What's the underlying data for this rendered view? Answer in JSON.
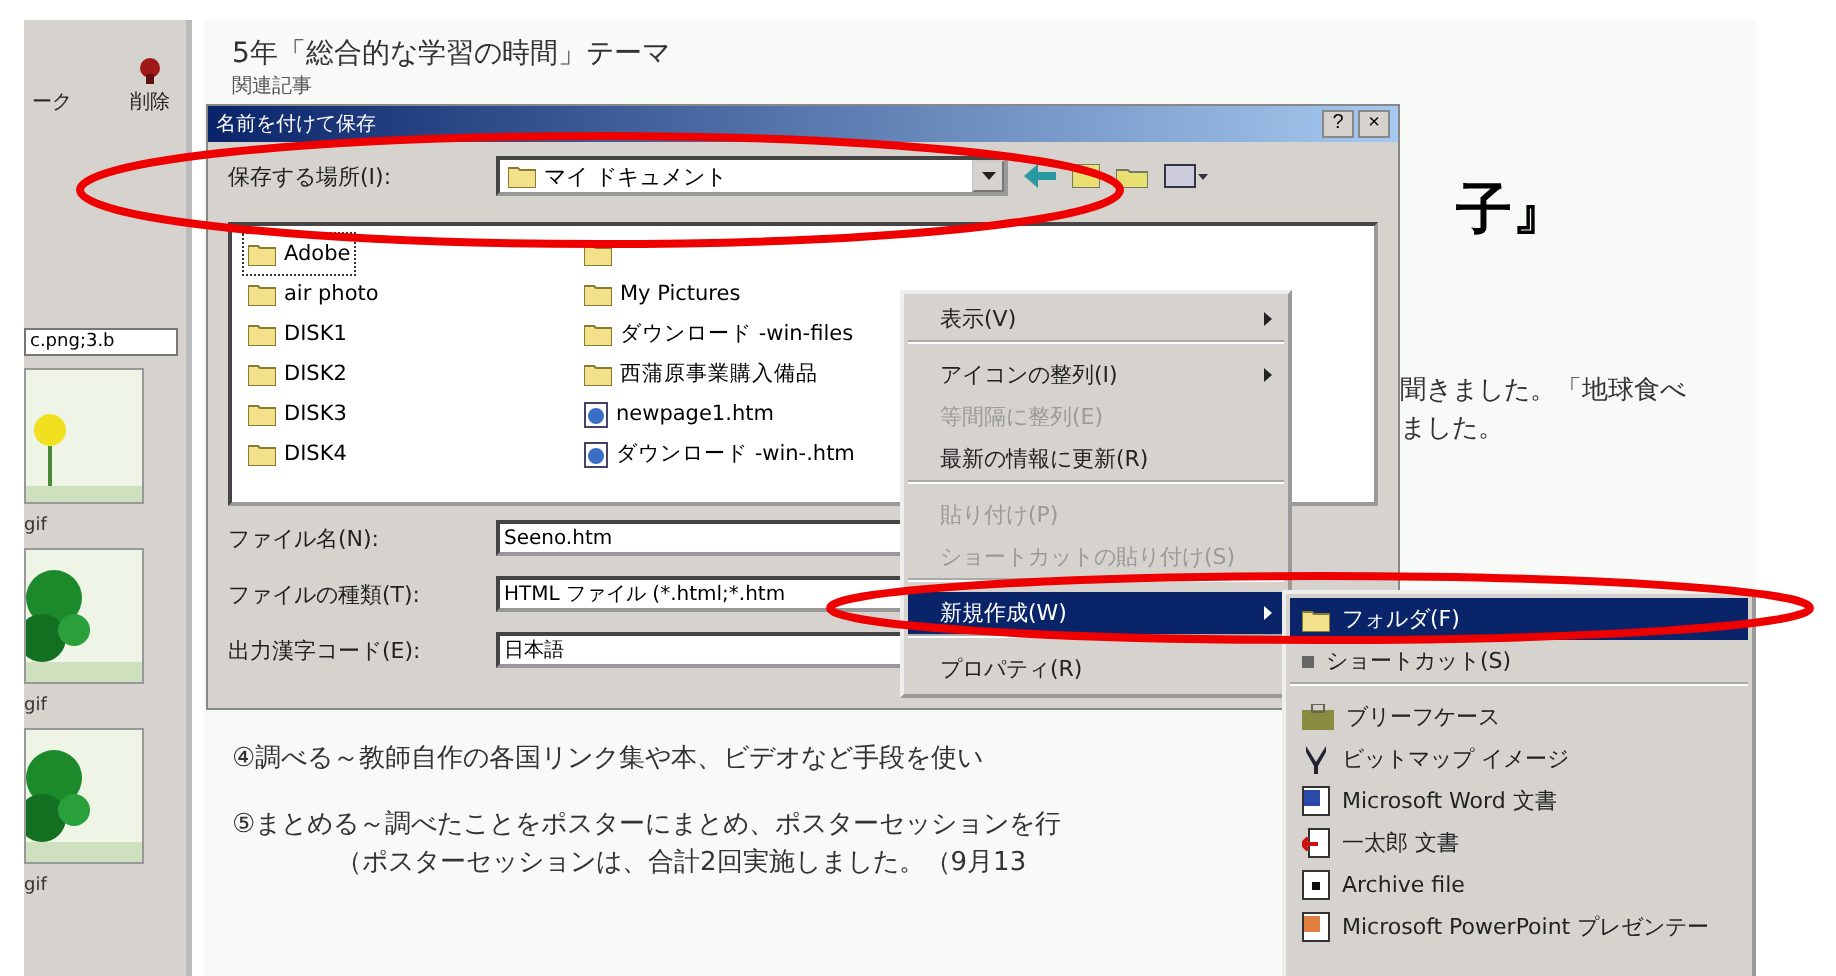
{
  "sidebar": {
    "toolbar": [
      {
        "label": "ーク"
      },
      {
        "label": "削除"
      }
    ],
    "filter": "c.png;3.b",
    "thumbnails": [
      {
        "caption": "gif"
      },
      {
        "caption": "gif"
      },
      {
        "caption": "gif"
      }
    ]
  },
  "document": {
    "heading": "5年「総合的な学習の時間」テーマ",
    "subheading": "関連記事",
    "big_title": "子』",
    "lines_right": [
      "聞きました。「地球食べ",
      "ました。"
    ],
    "lines_bottom": [
      "④調べる～教師自作の各国リンク集や本、ビデオなど手段を使い",
      "⑤まとめる～調べたことをポスターにまとめ、ポスターセッションを行",
      "　　　　（ポスターセッションは、合計2回実施しました。（9月13"
    ]
  },
  "dialog": {
    "title": "名前を付けて保存",
    "help": "?",
    "close": "×",
    "location_label": "保存する場所(I):",
    "location": "マイ ドキュメント",
    "files": [
      {
        "name": "Adobe",
        "kind": "folder",
        "selected": true
      },
      {
        "name": "air photo",
        "kind": "folder",
        "selected": false
      },
      {
        "name": "DISK1",
        "kind": "folder",
        "selected": false
      },
      {
        "name": "DISK2",
        "kind": "folder",
        "selected": false
      },
      {
        "name": "DISK3",
        "kind": "folder",
        "selected": false
      },
      {
        "name": "DISK4",
        "kind": "folder",
        "selected": false
      },
      {
        "kind": "folder",
        "selected": false
      },
      {
        "name": "My Pictures",
        "kind": "folder",
        "selected": false
      },
      {
        "name": "ダウンロード -win-files",
        "kind": "folder",
        "selected": false
      },
      {
        "name": "西蒲原事業購入備品",
        "kind": "folder",
        "selected": false
      },
      {
        "name": "newpage1.htm",
        "kind": "html",
        "selected": false
      },
      {
        "name": "ダウンロード -win-.htm",
        "kind": "html",
        "selected": false
      }
    ],
    "fields": [
      {
        "label": "ファイル名(N):",
        "value": "Seeno.htm"
      },
      {
        "label": "ファイルの種類(T):",
        "value": "HTML ファイル (*.html;*.htm"
      },
      {
        "label": "出力漢字コード(E):",
        "value": "日本語"
      }
    ]
  },
  "context_menu": [
    {
      "label": "表示(V)",
      "submenu": true,
      "disabled": false,
      "selected": false,
      "separator_after": true
    },
    {
      "label": "アイコンの整列(I)",
      "submenu": true,
      "disabled": false,
      "selected": false,
      "separator_after": false
    },
    {
      "label": "等間隔に整列(E)",
      "submenu": false,
      "disabled": true,
      "selected": false,
      "separator_after": false
    },
    {
      "label": "最新の情報に更新(R)",
      "submenu": false,
      "disabled": false,
      "selected": false,
      "separator_after": true
    },
    {
      "label": "貼り付け(P)",
      "submenu": false,
      "disabled": true,
      "selected": false,
      "separator_after": false
    },
    {
      "label": "ショートカットの貼り付け(S)",
      "submenu": false,
      "disabled": true,
      "selected": false,
      "separator_after": true
    },
    {
      "label": "新規作成(W)",
      "submenu": true,
      "disabled": false,
      "selected": true,
      "separator_after": true
    },
    {
      "label": "プロパティ(R)",
      "submenu": false,
      "disabled": false,
      "selected": false,
      "separator_after": false
    }
  ],
  "submenu": [
    {
      "label": "フォルダ(F)",
      "kind": "folder",
      "selected": true,
      "separator_after": false
    },
    {
      "label": "ショートカット(S)",
      "kind": "shortcut",
      "selected": false,
      "separator_after": true
    },
    {
      "label": "ブリーフケース",
      "kind": "briefcase",
      "selected": false,
      "separator_after": false
    },
    {
      "label": "ビットマップ イメージ",
      "kind": "bitmap",
      "selected": false,
      "separator_after": false
    },
    {
      "label": "Microsoft Word 文書",
      "kind": "word",
      "selected": false,
      "separator_after": false
    },
    {
      "label": "一太郎 文書",
      "kind": "ichitaro",
      "selected": false,
      "separator_after": false
    },
    {
      "label": "Archive file",
      "kind": "archive",
      "selected": false,
      "separator_after": false
    },
    {
      "label": "Microsoft PowerPoint プレゼンテー",
      "kind": "powerpoint",
      "selected": false,
      "separator_after": false
    }
  ]
}
